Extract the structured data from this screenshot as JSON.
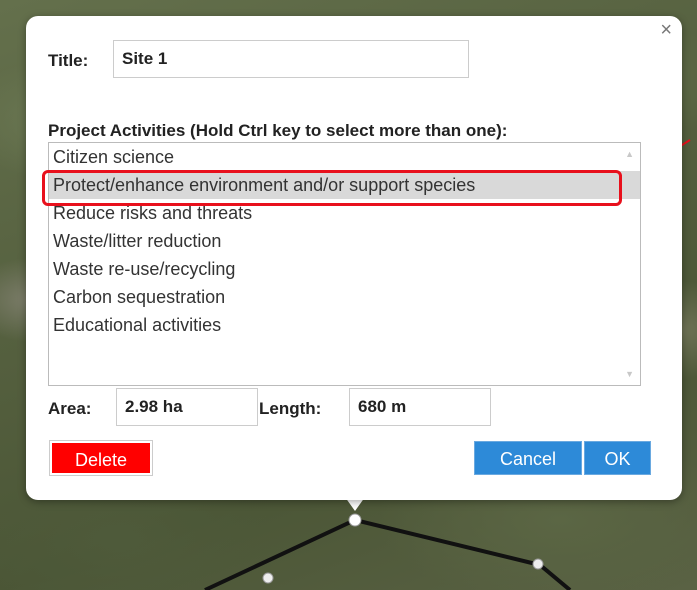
{
  "form": {
    "title_label": "Title:",
    "title_value": "Site 1",
    "activities_label": "Project Activities (Hold Ctrl key to select more than one):",
    "activities": [
      "Citizen science",
      "Protect/enhance environment and/or support species",
      "Reduce risks and threats",
      "Waste/litter reduction",
      "Waste re-use/recycling",
      "Carbon sequestration",
      "Educational activities"
    ],
    "selected_activity": "Protect/enhance environment and/or support species",
    "area_label": "Area:",
    "area_value": "2.98 ha",
    "length_label": "Length:",
    "length_value": "680 m"
  },
  "buttons": {
    "close": "×",
    "delete": "Delete",
    "cancel": "Cancel",
    "ok": "OK"
  },
  "scroll": {
    "up": "▲",
    "down": "▼"
  },
  "colors": {
    "delete": "#ff0000",
    "primary": "#2d8ad8",
    "annotation": "#e8101c",
    "selected_row": "#d9d9d9"
  }
}
